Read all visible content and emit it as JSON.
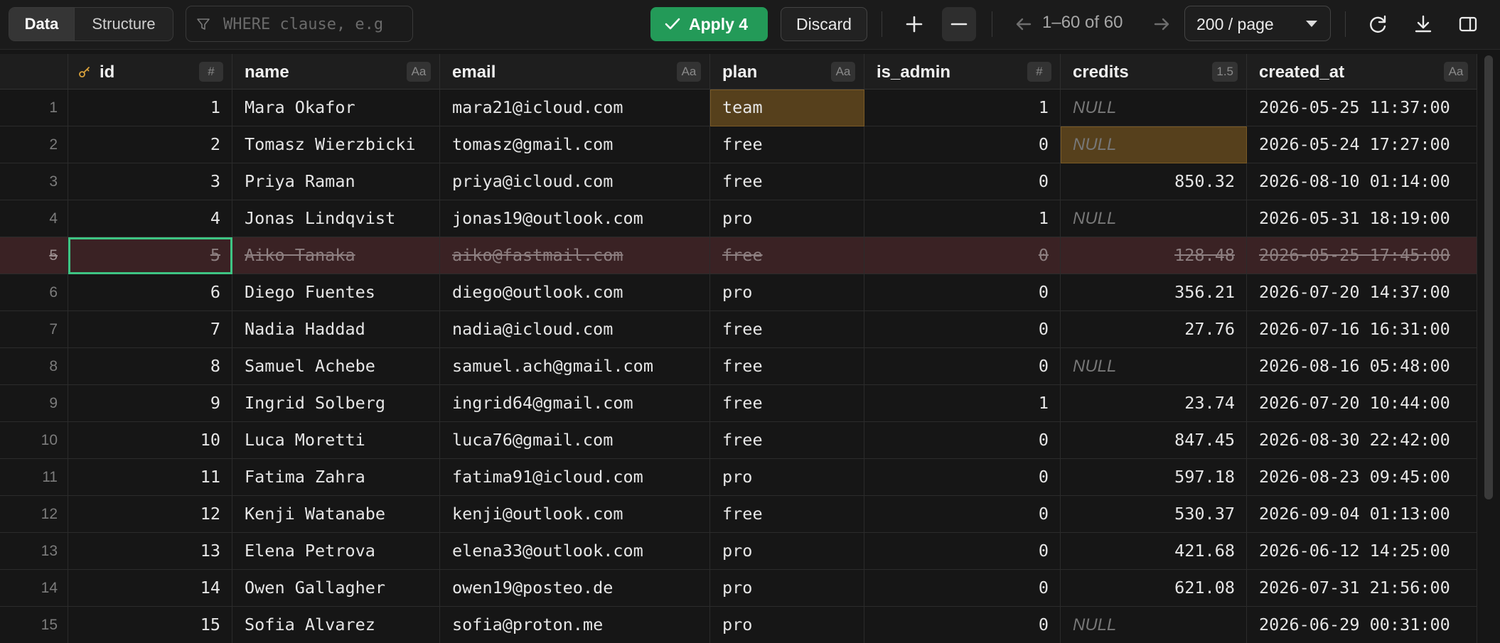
{
  "toolbar": {
    "tab_data": "Data",
    "tab_structure": "Structure",
    "filter_placeholder": "WHERE clause, e.g",
    "apply_label": "Apply 4",
    "discard_label": "Discard",
    "pagination": "1–60 of 60",
    "page_size": "200 / page",
    "icons": [
      "filter-icon",
      "check-icon",
      "plus-icon",
      "minus-icon",
      "arrow-left-icon",
      "arrow-right-icon",
      "chevron-down-icon",
      "refresh-icon",
      "download-icon",
      "sidebar-toggle-icon"
    ]
  },
  "columns": [
    {
      "name": "id",
      "type_badge": "#"
    },
    {
      "name": "name",
      "type_badge": "Aa"
    },
    {
      "name": "email",
      "type_badge": "Aa"
    },
    {
      "name": "plan",
      "type_badge": "Aa"
    },
    {
      "name": "is_admin",
      "type_badge": "#"
    },
    {
      "name": "credits",
      "type_badge": "1.5"
    },
    {
      "name": "created_at",
      "type_badge": "Aa"
    }
  ],
  "null_label": "NULL",
  "rows": [
    {
      "num": "1",
      "id": "1",
      "name": "Mara Okafor",
      "email": "mara21@icloud.com",
      "plan": "team",
      "is_admin": "1",
      "credits": null,
      "created_at": "2026-05-25 11:37:00",
      "edited": [
        "plan"
      ]
    },
    {
      "num": "2",
      "id": "2",
      "name": "Tomasz Wierzbicki",
      "email": "tomasz@gmail.com",
      "plan": "free",
      "is_admin": "0",
      "credits": null,
      "created_at": "2026-05-24 17:27:00",
      "edited": [
        "credits"
      ]
    },
    {
      "num": "3",
      "id": "3",
      "name": "Priya Raman",
      "email": "priya@icloud.com",
      "plan": "free",
      "is_admin": "0",
      "credits": "850.32",
      "created_at": "2026-08-10 01:14:00"
    },
    {
      "num": "4",
      "id": "4",
      "name": "Jonas Lindqvist",
      "email": "jonas19@outlook.com",
      "plan": "pro",
      "is_admin": "1",
      "credits": null,
      "created_at": "2026-05-31 18:19:00"
    },
    {
      "num": "5",
      "id": "5",
      "name": "Aiko Tanaka",
      "email": "aiko@fastmail.com",
      "plan": "free",
      "is_admin": "0",
      "credits": "128.48",
      "created_at": "2026-05-25 17:45:00",
      "deleted": true
    },
    {
      "num": "6",
      "id": "6",
      "name": "Diego Fuentes",
      "email": "diego@outlook.com",
      "plan": "pro",
      "is_admin": "0",
      "credits": "356.21",
      "created_at": "2026-07-20 14:37:00"
    },
    {
      "num": "7",
      "id": "7",
      "name": "Nadia Haddad",
      "email": "nadia@icloud.com",
      "plan": "free",
      "is_admin": "0",
      "credits": "27.76",
      "created_at": "2026-07-16 16:31:00"
    },
    {
      "num": "8",
      "id": "8",
      "name": "Samuel Achebe",
      "email": "samuel.ach@gmail.com",
      "plan": "free",
      "is_admin": "0",
      "credits": null,
      "created_at": "2026-08-16 05:48:00"
    },
    {
      "num": "9",
      "id": "9",
      "name": "Ingrid Solberg",
      "email": "ingrid64@gmail.com",
      "plan": "free",
      "is_admin": "1",
      "credits": "23.74",
      "created_at": "2026-07-20 10:44:00"
    },
    {
      "num": "10",
      "id": "10",
      "name": "Luca Moretti",
      "email": "luca76@gmail.com",
      "plan": "free",
      "is_admin": "0",
      "credits": "847.45",
      "created_at": "2026-08-30 22:42:00"
    },
    {
      "num": "11",
      "id": "11",
      "name": "Fatima Zahra",
      "email": "fatima91@icloud.com",
      "plan": "pro",
      "is_admin": "0",
      "credits": "597.18",
      "created_at": "2026-08-23 09:45:00"
    },
    {
      "num": "12",
      "id": "12",
      "name": "Kenji Watanabe",
      "email": "kenji@outlook.com",
      "plan": "free",
      "is_admin": "0",
      "credits": "530.37",
      "created_at": "2026-09-04 01:13:00"
    },
    {
      "num": "13",
      "id": "13",
      "name": "Elena Petrova",
      "email": "elena33@outlook.com",
      "plan": "pro",
      "is_admin": "0",
      "credits": "421.68",
      "created_at": "2026-06-12 14:25:00"
    },
    {
      "num": "14",
      "id": "14",
      "name": "Owen Gallagher",
      "email": "owen19@posteo.de",
      "plan": "pro",
      "is_admin": "0",
      "credits": "621.08",
      "created_at": "2026-07-31 21:56:00"
    },
    {
      "num": "15",
      "id": "15",
      "name": "Sofia Alvarez",
      "email": "sofia@proton.me",
      "plan": "pro",
      "is_admin": "0",
      "credits": null,
      "created_at": "2026-06-29 00:31:00"
    }
  ],
  "colors": {
    "accent_green": "#239a58",
    "selection_outline": "#3ec483",
    "edited_cell": "#56401c",
    "deleted_row": "#3a2224"
  }
}
